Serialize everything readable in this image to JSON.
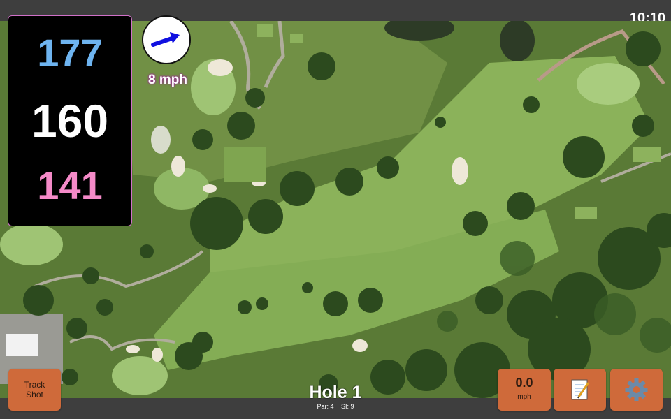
{
  "status": {
    "time": "10:10"
  },
  "yardage": {
    "back": "177",
    "middle": "160",
    "front": "141"
  },
  "wind": {
    "label": "8 mph",
    "icon": "wind-direction-arrow-icon"
  },
  "buttons": {
    "track_shot_line1": "Track",
    "track_shot_line2": "Shot",
    "speed_value": "0.0",
    "speed_unit": "mph",
    "notes_icon": "notepad-icon",
    "settings_icon": "gear-icon"
  },
  "hole": {
    "title": "Hole 1",
    "par": "Par: 4",
    "si": "SI: 9"
  },
  "colors": {
    "button": "#cf6a3a",
    "back": "#6eb4f0",
    "front": "#f58ac8",
    "middle": "#ffffff"
  }
}
